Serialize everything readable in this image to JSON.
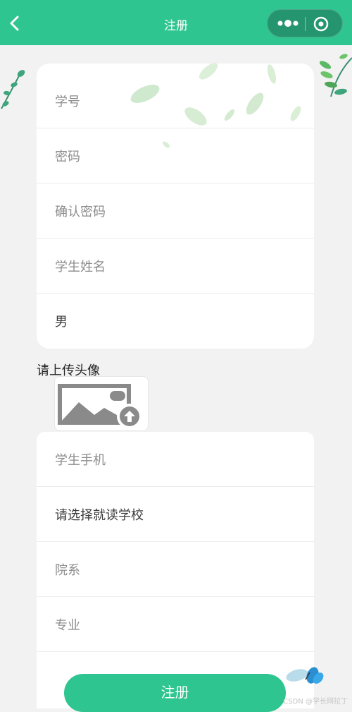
{
  "navbar": {
    "title": "注册",
    "accent_color": "#2fc591",
    "back_icon": "chevron-left-icon",
    "more_icon": "more-dots-icon",
    "close_icon": "target-circle-icon"
  },
  "form": {
    "student_id_placeholder": "学号",
    "password_placeholder": "密码",
    "confirm_password_placeholder": "确认密码",
    "student_name_placeholder": "学生姓名",
    "gender_value": "男",
    "avatar_label": "请上传头像",
    "phone_placeholder": "学生手机",
    "school_select_placeholder": "请选择就读学校",
    "department_placeholder": "院系",
    "major_placeholder": "专业"
  },
  "submit_label": "注册",
  "watermark": "CSDN @学长网拉丁"
}
